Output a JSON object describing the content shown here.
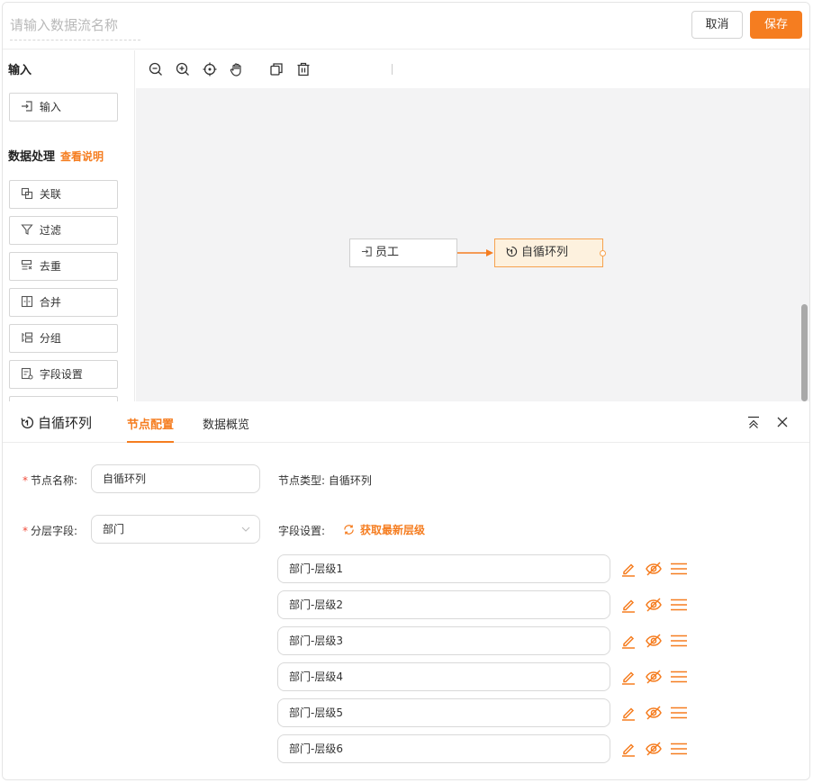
{
  "header": {
    "flow_name_placeholder": "请输入数据流名称",
    "cancel_label": "取消",
    "save_label": "保存"
  },
  "left_panel": {
    "input_section_title": "输入",
    "input_tools": [
      {
        "label": "输入",
        "icon": "input-icon"
      }
    ],
    "processing_section_title": "数据处理",
    "help_link": "查看说明",
    "processing_tools": [
      {
        "label": "关联",
        "icon": "join-icon"
      },
      {
        "label": "过滤",
        "icon": "filter-icon"
      },
      {
        "label": "去重",
        "icon": "dedupe-icon"
      },
      {
        "label": "合并",
        "icon": "merge-icon"
      },
      {
        "label": "分组",
        "icon": "group-icon"
      },
      {
        "label": "字段设置",
        "icon": "field-settings-icon"
      }
    ]
  },
  "canvas": {
    "toolbar_icons": [
      "zoom-out-icon",
      "zoom-in-icon",
      "center-icon",
      "pan-hand-icon",
      "copy-icon",
      "delete-icon"
    ],
    "nodes": [
      {
        "label": "员工",
        "icon": "input-icon"
      },
      {
        "label": "自循环列",
        "icon": "self-loop-icon"
      }
    ]
  },
  "panel": {
    "title": "自循环列",
    "tabs": [
      "节点配置",
      "数据概览"
    ],
    "node_name_label": "节点名称:",
    "node_name_value": "自循环列",
    "node_type_label": "节点类型:",
    "node_type_value": "自循环列",
    "layer_field_label": "分层字段:",
    "layer_field_value": "部门",
    "field_settings_label": "字段设置:",
    "refresh_label": "获取最新层级",
    "levels": [
      "部门-层级1",
      "部门-层级2",
      "部门-层级3",
      "部门-层级4",
      "部门-层级5",
      "部门-层级6"
    ]
  },
  "colors": {
    "accent": "#f57d20",
    "required": "#f04c3b",
    "node_selected_bg": "#fdf1de"
  }
}
